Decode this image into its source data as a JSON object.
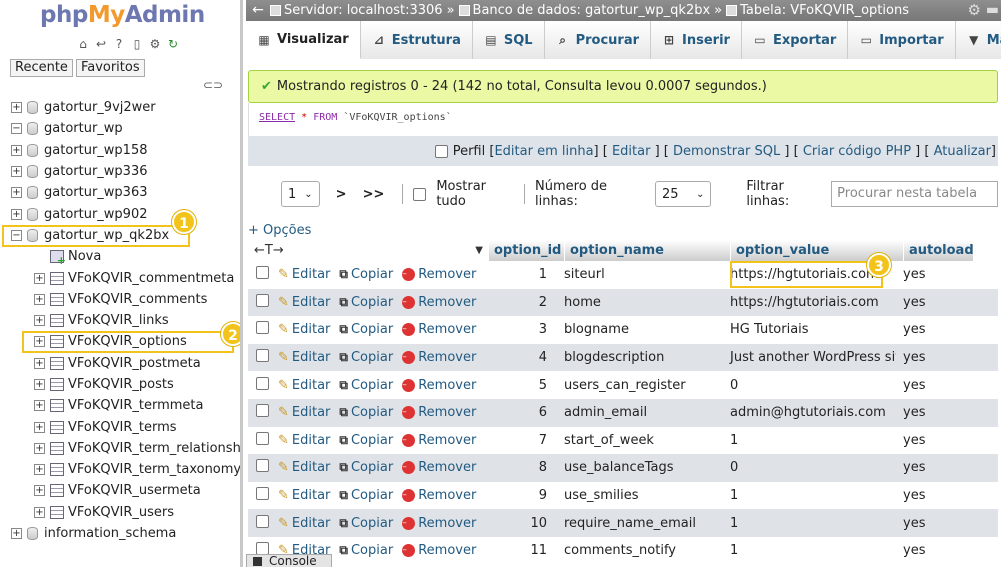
{
  "logo": {
    "php": "php",
    "my": "My",
    "admin": "Admin"
  },
  "sidebar": {
    "tab_recent": "Recente",
    "tab_favorites": "Favoritos",
    "databases": [
      {
        "label": "gatortur_9vj2wer",
        "expander": "+"
      },
      {
        "label": "gatortur_wp",
        "expander": "−"
      },
      {
        "label": "gatortur_wp158",
        "expander": "+"
      },
      {
        "label": "gatortur_wp336",
        "expander": "+"
      },
      {
        "label": "gatortur_wp363",
        "expander": "+"
      },
      {
        "label": "gatortur_wp902",
        "expander": "+"
      },
      {
        "label": "gatortur_wp_qk2bx",
        "expander": "−"
      }
    ],
    "new_label": "Nova",
    "tables": [
      "VFoKQVIR_commentmeta",
      "VFoKQVIR_comments",
      "VFoKQVIR_links",
      "VFoKQVIR_options",
      "VFoKQVIR_postmeta",
      "VFoKQVIR_posts",
      "VFoKQVIR_termmeta",
      "VFoKQVIR_terms",
      "VFoKQVIR_term_relationships",
      "VFoKQVIR_term_taxonomy",
      "VFoKQVIR_usermeta",
      "VFoKQVIR_users"
    ],
    "info_schema": "information_schema",
    "badge1": "1",
    "badge2": "2"
  },
  "breadcrumb": {
    "server": "Servidor: localhost:3306",
    "database": "Banco de dados: gatortur_wp_qk2bx",
    "table": "Tabela: VFoKQVIR_options",
    "sep": "»"
  },
  "tabs": [
    "Visualizar",
    "Estrutura",
    "SQL",
    "Procurar",
    "Inserir",
    "Exportar",
    "Importar",
    "Mais"
  ],
  "message": "Mostrando registros 0 - 24 (142 no total, Consulta levou 0.0007 segundos.)",
  "sql": {
    "select": "SELECT",
    "star": "*",
    "from": "FROM",
    "table": "`VFoKQVIR_options`"
  },
  "sql_options": {
    "profile": "Perfil",
    "links": [
      "Editar em linha",
      "Editar",
      "Demonstrar SQL",
      "Criar código PHP",
      "Atualizar"
    ]
  },
  "navigation": {
    "page": "1",
    "next": ">",
    "last": ">>",
    "show_all": "Mostrar tudo",
    "rows_label": "Número de linhas:",
    "rows_value": "25",
    "filter_label": "Filtrar linhas:",
    "filter_placeholder": "Procurar nesta tabela"
  },
  "options_link": "+ Opções",
  "columns": [
    "option_id",
    "option_name",
    "option_value",
    "autoload"
  ],
  "actions": {
    "edit": "Editar",
    "copy": "Copiar",
    "remove": "Remover"
  },
  "rows": [
    {
      "id": "1",
      "name": "siteurl",
      "value": "https://hgtutoriais.com",
      "autoload": "yes"
    },
    {
      "id": "2",
      "name": "home",
      "value": "https://hgtutoriais.com",
      "autoload": "yes"
    },
    {
      "id": "3",
      "name": "blogname",
      "value": "HG Tutoriais",
      "autoload": "yes"
    },
    {
      "id": "4",
      "name": "blogdescription",
      "value": "Just another WordPress site",
      "autoload": "yes"
    },
    {
      "id": "5",
      "name": "users_can_register",
      "value": "0",
      "autoload": "yes"
    },
    {
      "id": "6",
      "name": "admin_email",
      "value": "admin@hgtutoriais.com",
      "autoload": "yes"
    },
    {
      "id": "7",
      "name": "start_of_week",
      "value": "1",
      "autoload": "yes"
    },
    {
      "id": "8",
      "name": "use_balanceTags",
      "value": "0",
      "autoload": "yes"
    },
    {
      "id": "9",
      "name": "use_smilies",
      "value": "1",
      "autoload": "yes"
    },
    {
      "id": "10",
      "name": "require_name_email",
      "value": "1",
      "autoload": "yes"
    },
    {
      "id": "11",
      "name": "comments_notify",
      "value": "1",
      "autoload": "yes"
    }
  ],
  "badge3": "3",
  "console": "Console",
  "colors": {
    "accent": "#235a81",
    "highlight": "#f2c31a",
    "success_bg": "#ebf8a4"
  }
}
